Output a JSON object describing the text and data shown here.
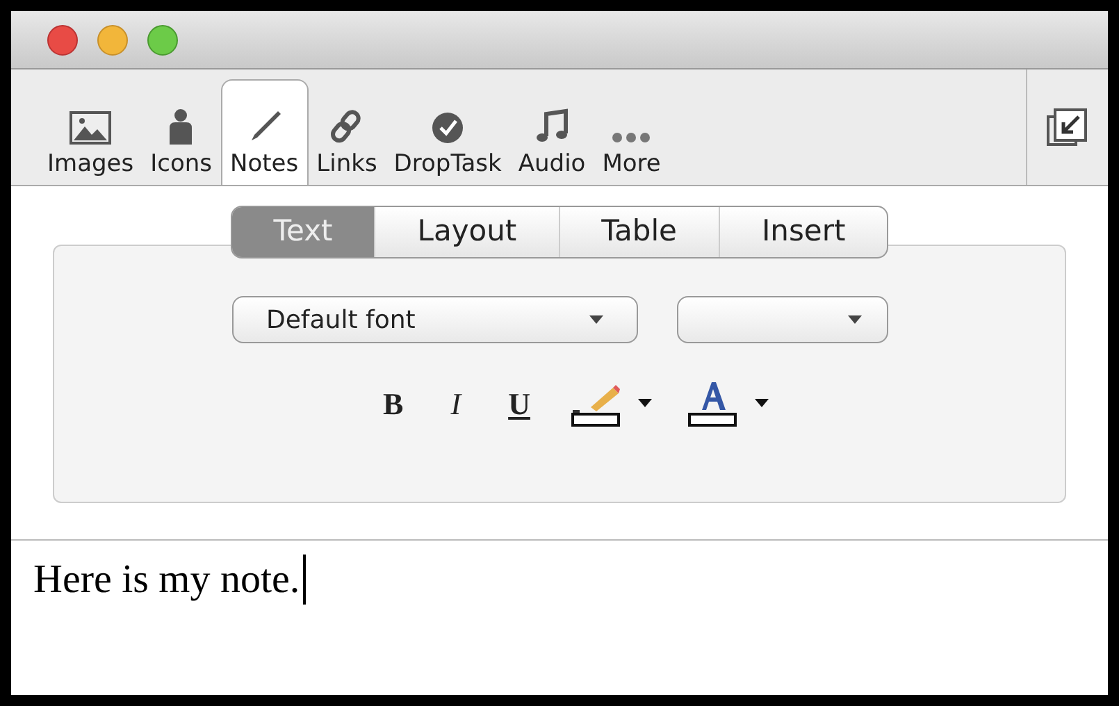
{
  "toolbar": {
    "items": [
      {
        "label": "Images",
        "kind": "image",
        "selected": false
      },
      {
        "label": "Icons",
        "kind": "person",
        "selected": false
      },
      {
        "label": "Notes",
        "kind": "pen",
        "selected": true
      },
      {
        "label": "Links",
        "kind": "link",
        "selected": false
      },
      {
        "label": "DropTask",
        "kind": "check",
        "selected": false
      },
      {
        "label": "Audio",
        "kind": "music",
        "selected": false
      },
      {
        "label": "More",
        "kind": "dots",
        "selected": false
      }
    ]
  },
  "tabs": [
    {
      "label": "Text",
      "selected": true
    },
    {
      "label": "Layout",
      "selected": false
    },
    {
      "label": "Table",
      "selected": false
    },
    {
      "label": "Insert",
      "selected": false
    }
  ],
  "font_select": {
    "value": "Default font"
  },
  "format_buttons": [
    {
      "kind": "bold",
      "label": "B"
    },
    {
      "kind": "italic",
      "label": "I"
    },
    {
      "kind": "underline",
      "label": "U"
    },
    {
      "kind": "highlight"
    },
    {
      "kind": "color"
    }
  ],
  "note": {
    "text": "Here is my note."
  }
}
